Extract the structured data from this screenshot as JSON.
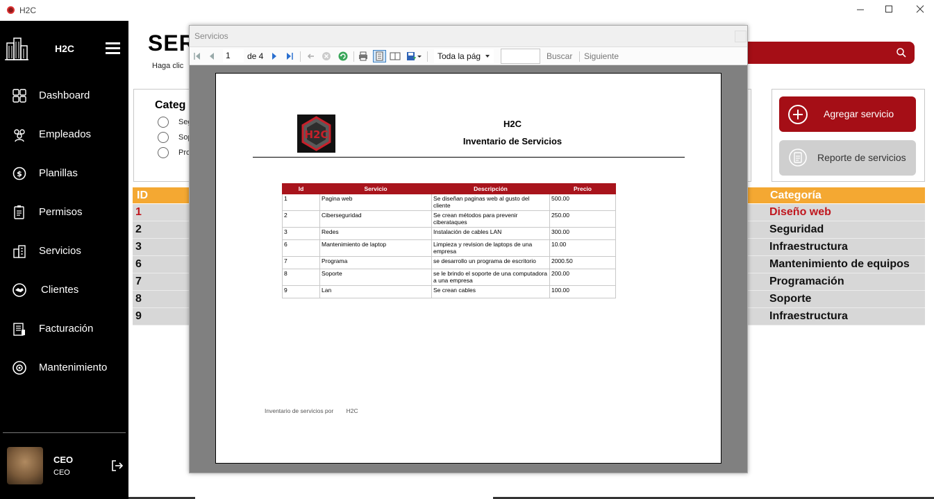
{
  "window": {
    "title": "H2C"
  },
  "sidebar": {
    "brand": "H2C",
    "items": [
      {
        "label": "Dashboard",
        "icon": "dashboard-icon"
      },
      {
        "label": "Empleados",
        "icon": "employees-icon"
      },
      {
        "label": "Planillas",
        "icon": "payroll-icon"
      },
      {
        "label": "Permisos",
        "icon": "permissions-icon"
      },
      {
        "label": "Servicios",
        "icon": "services-icon"
      },
      {
        "label": "Clientes",
        "icon": "clients-icon"
      },
      {
        "label": "Facturación",
        "icon": "billing-icon"
      },
      {
        "label": "Mantenimiento",
        "icon": "maintenance-icon"
      }
    ],
    "user": {
      "name": "CEO",
      "role": "CEO"
    }
  },
  "main": {
    "title": "SERV",
    "hint": "Haga clic",
    "categories": {
      "title": "Categ",
      "options": [
        "Seg",
        "Sop",
        "Pro"
      ]
    },
    "actions": {
      "add_label": "Agregar servicio",
      "report_label": "Reporte de servicios"
    },
    "grid": {
      "columns": {
        "id": "ID",
        "category": "Categoría"
      },
      "rows": [
        {
          "id": "1",
          "category": "Diseño web",
          "selected": true
        },
        {
          "id": "2",
          "category": "Seguridad"
        },
        {
          "id": "3",
          "category": "Infraestructura"
        },
        {
          "id": "6",
          "category": "Mantenimiento de equipos"
        },
        {
          "id": "7",
          "category": "Programación"
        },
        {
          "id": "8",
          "category": "Soporte"
        },
        {
          "id": "9",
          "category": "Infraestructura"
        }
      ]
    }
  },
  "report_dialog": {
    "title": "Servicios",
    "toolbar": {
      "current_page": "1",
      "of_pages": "de 4",
      "zoom": "Toda la pág",
      "find_label": "Buscar",
      "next_label": "Siguiente"
    },
    "report": {
      "company": "H2C",
      "title": "Inventario de Servicios",
      "columns": [
        "Id",
        "Servicio",
        "Descripción",
        "Precio"
      ],
      "rows": [
        [
          "1",
          "Pagina web",
          "Se diseñan paginas web al gusto del cliente",
          "500.00"
        ],
        [
          "2",
          "Ciberseguridad",
          "Se crean métodos para prevenir ciberataques",
          "250.00"
        ],
        [
          "3",
          "Redes",
          "Instalación de cables LAN",
          "300.00"
        ],
        [
          "6",
          "Mantenimiento de laptop",
          "Limpieza y revision de laptops de una empresa",
          "10.00"
        ],
        [
          "7",
          "Programa",
          "se desarrollo un programa de escritorio",
          "2000.50"
        ],
        [
          "8",
          "Soporte",
          "se le brindo el soporte de una computadora a una empresa",
          "200.00"
        ],
        [
          "9",
          "Lan",
          "Se crean cables",
          "100.00"
        ]
      ],
      "footer_label": "Inventario de servicios por",
      "footer_company": "H2C"
    }
  },
  "colors": {
    "sidebar_bg": "#000000",
    "accent_red": "#a50e16",
    "grid_header": "#f4a832",
    "grid_row": "#d7d7d7",
    "report_header": "#a8141c"
  }
}
